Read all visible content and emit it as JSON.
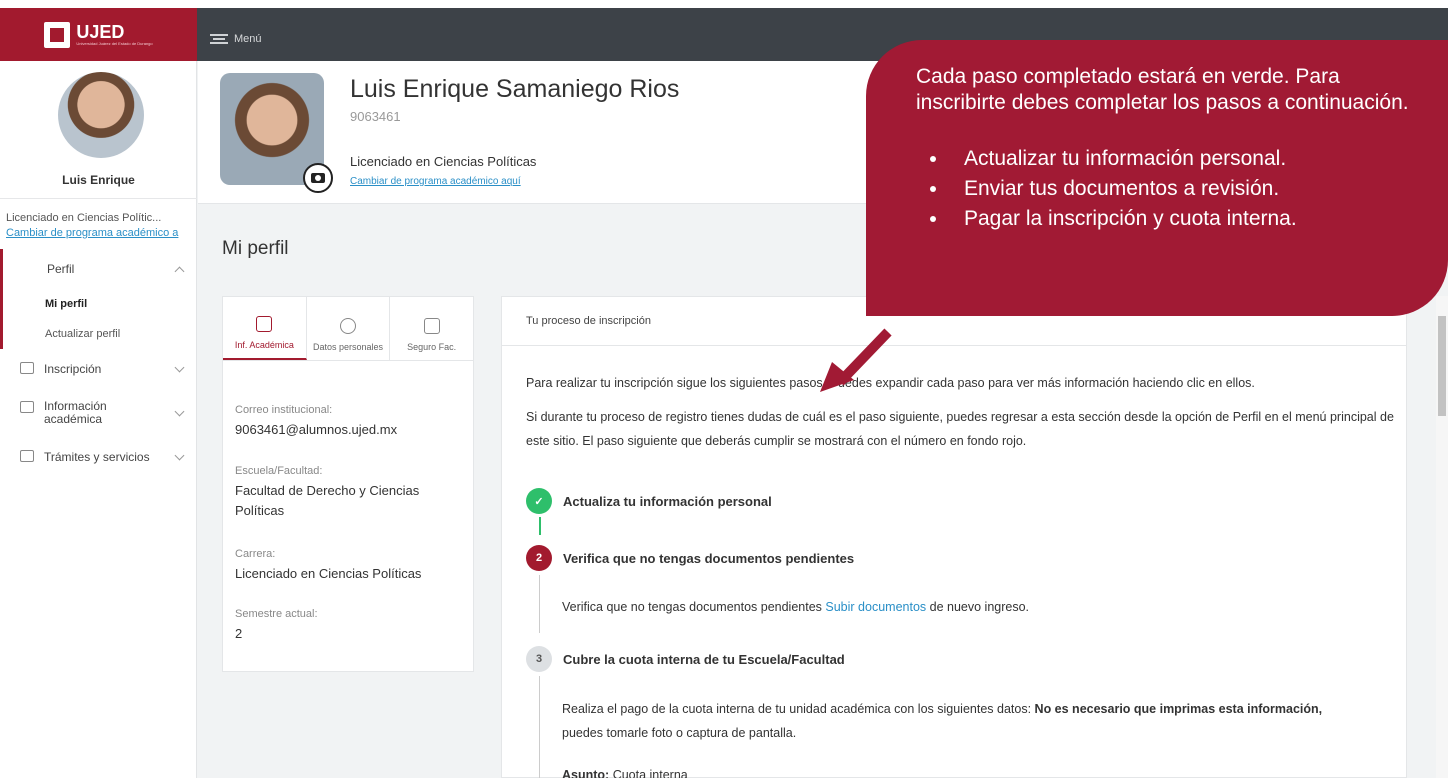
{
  "brand": {
    "name": "UJED",
    "subtitle": "Universidad Juárez del Estado de Durango"
  },
  "topbar": {
    "menu_label": "Menú"
  },
  "sidebar": {
    "user_name": "Luis Enrique",
    "program": "Licenciado en Ciencias Polític...",
    "change_program": "Cambiar de programa académico a",
    "nav": {
      "perfil": "Perfil",
      "mi_perfil": "Mi perfil",
      "actualizar": "Actualizar perfil",
      "inscripcion": "Inscripción",
      "info_academica": "Información académica",
      "tramites": "Trámites y servicios"
    }
  },
  "header": {
    "name": "Luis Enrique Samaniego Rios",
    "id": "9063461",
    "program": "Licenciado en Ciencias Políticas",
    "change_link": "Cambiar de programa académico aquí"
  },
  "page_title": "Mi perfil",
  "tabs": [
    {
      "label": "Inf. Académica",
      "active": true
    },
    {
      "label": "Datos personales",
      "active": false
    },
    {
      "label": "Seguro Fac.",
      "active": false
    }
  ],
  "fields": {
    "correo_label": "Correo institucional:",
    "correo_value": "9063461@alumnos.ujed.mx",
    "escuela_label": "Escuela/Facultad:",
    "escuela_value": "Facultad de Derecho y Ciencias Políticas",
    "carrera_label": "Carrera:",
    "carrera_value": "Licenciado en Ciencias Políticas",
    "semestre_label": "Semestre actual:",
    "semestre_value": "2"
  },
  "process": {
    "title": "Tu proceso de inscripción",
    "p1": "Para realizar tu inscripción sigue los siguientes pasos. Puedes expandir cada paso para ver más información haciendo clic en ellos.",
    "p2": "Si durante tu proceso de registro tienes dudas de cuál es el paso siguiente, puedes regresar a esta sección desde la opción de Perfil en el menú principal de este sitio. El paso siguiente que deberás cumplir se mostrará con el número en fondo rojo.",
    "step1": {
      "num": "✓",
      "title": "Actualiza tu información personal"
    },
    "step2": {
      "num": "2",
      "title": "Verifica que no tengas documentos pendientes"
    },
    "step2_text": "Verifica que no tengas documentos pendientes",
    "step2_link": "Subir documentos",
    "step2_tail": "de nuevo ingreso.",
    "step3": {
      "num": "3",
      "title": "Cubre la cuota interna de tu Escuela/Facultad"
    },
    "step3_text": "Realiza el pago de la cuota interna de tu unidad académica con los siguientes datos:",
    "step3_bold": "No es necesario que imprimas esta información,",
    "step3_tail": "puedes tomarle foto o captura de pantalla.",
    "asunto_label": "Asunto:",
    "asunto_value": "Cuota interna"
  },
  "callout": {
    "title": "Cada paso completado estará en verde. Para inscribirte debes completar los pasos a continuación.",
    "items": [
      "Actualizar tu información personal.",
      "Enviar tus documentos a revisión.",
      "Pagar la inscripción y cuota interna."
    ]
  },
  "colors": {
    "brand": "#a21a2e",
    "done": "#2ebf6b",
    "link": "#2a8fc7",
    "topbar": "#3d4248"
  }
}
